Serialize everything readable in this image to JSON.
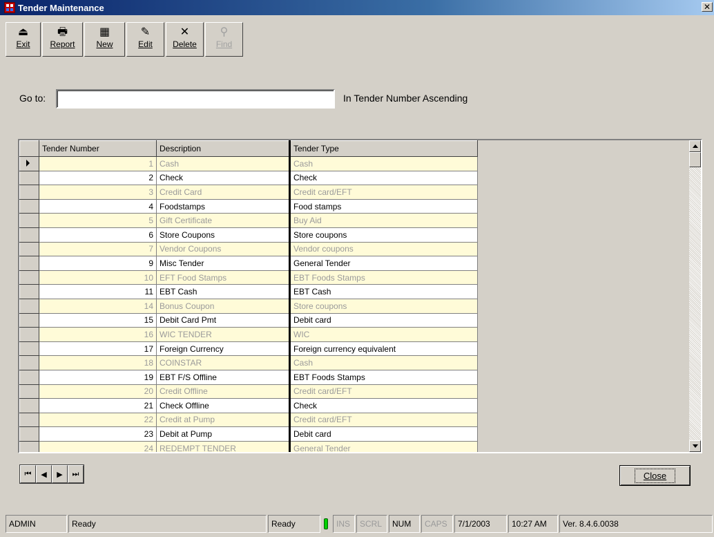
{
  "window": {
    "title": "Tender Maintenance",
    "close_glyph": "✕"
  },
  "toolbar": {
    "buttons": [
      {
        "label": "Exit",
        "icon": "⏏",
        "disabled": false
      },
      {
        "label": "Report",
        "icon": "🖶",
        "disabled": false
      },
      {
        "label": "New",
        "icon": "▦",
        "disabled": false
      },
      {
        "label": "Edit",
        "icon": "✎",
        "disabled": false
      },
      {
        "label": "Delete",
        "icon": "✕",
        "disabled": false
      },
      {
        "label": "Find",
        "icon": "⚲",
        "disabled": true
      }
    ]
  },
  "goto": {
    "label": "Go to:",
    "value": "",
    "order_text": "In Tender Number Ascending"
  },
  "grid": {
    "columns": [
      "Tender Number",
      "Description",
      "Tender Type"
    ],
    "rows": [
      {
        "number": "1",
        "description": "Cash",
        "type": "Cash"
      },
      {
        "number": "2",
        "description": "Check",
        "type": "Check"
      },
      {
        "number": "3",
        "description": "Credit Card",
        "type": "Credit card/EFT"
      },
      {
        "number": "4",
        "description": "Foodstamps",
        "type": "Food stamps"
      },
      {
        "number": "5",
        "description": "Gift Certificate",
        "type": "Buy Aid"
      },
      {
        "number": "6",
        "description": "Store Coupons",
        "type": "Store coupons"
      },
      {
        "number": "7",
        "description": "Vendor Coupons",
        "type": "Vendor coupons"
      },
      {
        "number": "9",
        "description": "Misc Tender",
        "type": "General Tender"
      },
      {
        "number": "10",
        "description": "EFT Food Stamps",
        "type": "EBT Foods Stamps"
      },
      {
        "number": "11",
        "description": "EBT Cash",
        "type": "EBT Cash"
      },
      {
        "number": "14",
        "description": "Bonus Coupon",
        "type": "Store coupons"
      },
      {
        "number": "15",
        "description": "Debit Card Pmt",
        "type": "Debit card"
      },
      {
        "number": "16",
        "description": "WIC TENDER",
        "type": "WIC"
      },
      {
        "number": "17",
        "description": "Foreign Currency",
        "type": "Foreign currency equivalent"
      },
      {
        "number": "18",
        "description": "COINSTAR",
        "type": "Cash"
      },
      {
        "number": "19",
        "description": "EBT F/S Offline",
        "type": "EBT Foods Stamps"
      },
      {
        "number": "20",
        "description": "Credit Offline",
        "type": "Credit card/EFT"
      },
      {
        "number": "21",
        "description": "Check Offline",
        "type": "Check"
      },
      {
        "number": "22",
        "description": "Credit at Pump",
        "type": "Credit card/EFT"
      },
      {
        "number": "23",
        "description": "Debit at Pump",
        "type": "Debit card"
      },
      {
        "number": "24",
        "description": "REDEMPT TENDER",
        "type": "General Tender"
      }
    ]
  },
  "nav_buttons": {
    "first": "⏮",
    "prev": "◀",
    "next": "▶",
    "last": "⏭"
  },
  "close_button": {
    "label": "Close"
  },
  "status": {
    "user": "ADMIN",
    "message": "Ready",
    "state": "Ready",
    "ins": "INS",
    "scrl": "SCRL",
    "num": "NUM",
    "caps": "CAPS",
    "date": "7/1/2003",
    "time": "10:27 AM",
    "version": "Ver. 8.4.6.0038"
  },
  "colors": {
    "title_bar": "#0a246a",
    "row_alt": "#fffbd8",
    "indicator": "#00d000"
  }
}
